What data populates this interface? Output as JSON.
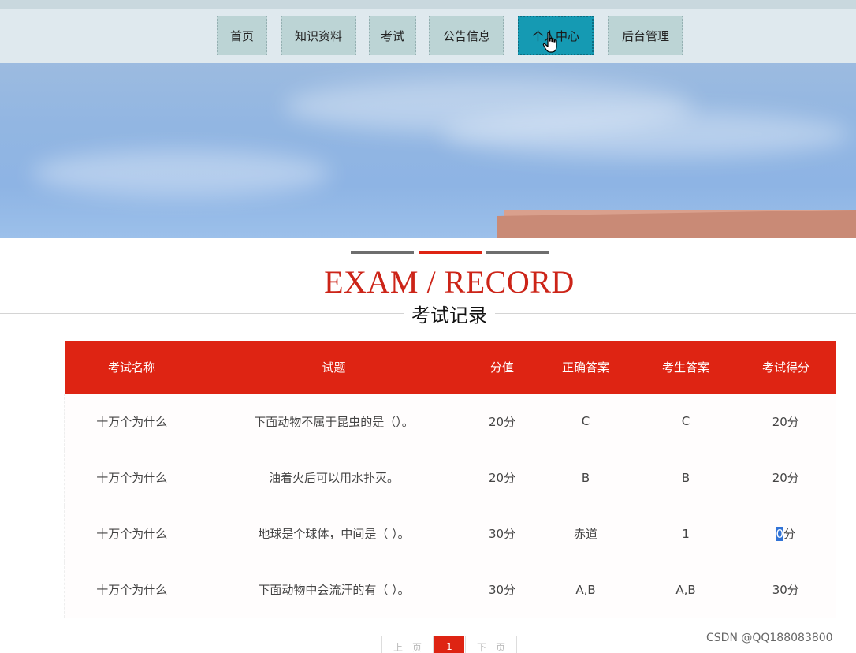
{
  "nav": {
    "items": [
      {
        "label": "首页"
      },
      {
        "label": "知识资料"
      },
      {
        "label": "考试"
      },
      {
        "label": "公告信息"
      },
      {
        "label": "个人中心",
        "active": true
      },
      {
        "label": "后台管理"
      }
    ]
  },
  "section": {
    "title_en": "EXAM / RECORD",
    "title_cn": "考试记录"
  },
  "table": {
    "headers": [
      "考试名称",
      "试题",
      "分值",
      "正确答案",
      "考生答案",
      "考试得分"
    ],
    "rows": [
      {
        "exam": "十万个为什么",
        "question": "下面动物不属于昆虫的是（）。",
        "points": "20分",
        "correct": "C",
        "student": "C",
        "score": "20分"
      },
      {
        "exam": "十万个为什么",
        "question": "油着火后可以用水扑灭。",
        "points": "20分",
        "correct": "B",
        "student": "B",
        "score": "20分"
      },
      {
        "exam": "十万个为什么",
        "question": "地球是个球体，中间是（ ）。",
        "points": "30分",
        "correct": "赤道",
        "student": "1",
        "score_selected": "0",
        "score_unit": "分"
      },
      {
        "exam": "十万个为什么",
        "question": "下面动物中会流汗的有（ ）。",
        "points": "30分",
        "correct": "A,B",
        "student": "A,B",
        "score": "30分"
      }
    ]
  },
  "pagination": {
    "prev": "上一页",
    "current": "1",
    "next": "下一页"
  },
  "watermark": "CSDN @QQ188083800",
  "colors": {
    "accent_red": "#de2413",
    "nav_active": "#159ab3"
  }
}
